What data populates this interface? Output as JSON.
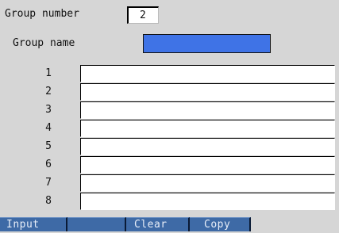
{
  "group_number": {
    "label": "Group number",
    "value": "2"
  },
  "group_name": {
    "label": "Group name",
    "value": ""
  },
  "rows": [
    {
      "num": "1",
      "value": ""
    },
    {
      "num": "2",
      "value": ""
    },
    {
      "num": "3",
      "value": ""
    },
    {
      "num": "4",
      "value": ""
    },
    {
      "num": "5",
      "value": ""
    },
    {
      "num": "6",
      "value": ""
    },
    {
      "num": "7",
      "value": ""
    },
    {
      "num": "8",
      "value": ""
    }
  ],
  "softkeys": [
    "Input",
    "",
    "Clear",
    "Copy"
  ],
  "colors": {
    "background": "#d6d6d6",
    "group_name_highlight": "#3f73e6",
    "softkey_bg": "#3e6aa6"
  }
}
